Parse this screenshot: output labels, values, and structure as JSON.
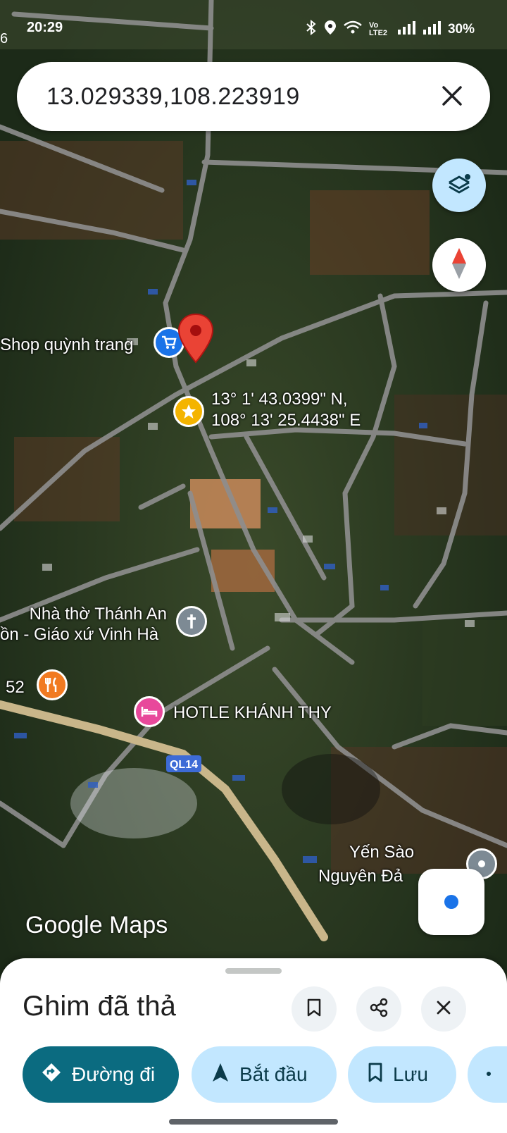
{
  "status_bar": {
    "time": "20:29",
    "edge_text": "6",
    "network": "Vo LTE2",
    "battery": "30%"
  },
  "search": {
    "query": "13.029339,108.223919"
  },
  "map": {
    "labels": {
      "shop": "Shop quỳnh trang",
      "pin_coords_line1": "13° 1' 43.0399\" N,",
      "pin_coords_line2": "108° 13' 25.4438\" E",
      "church_line1": "Nhà thờ Thánh An",
      "church_line2": "ồn - Giáo xứ Vinh Hà",
      "restaurant": "52",
      "hotel": "HOTLE KHÁNH THY",
      "road": "QL14",
      "place_line1": "Yến Sào",
      "place_line2": "Nguyên Đả"
    },
    "watermark_google": "Google",
    "watermark_maps": "Maps"
  },
  "sheet": {
    "title": "Ghim đã thả",
    "actions": {
      "directions": "Đường đi",
      "start": "Bắt đầu",
      "save": "Lưu"
    }
  },
  "colors": {
    "primary_button": "#0b6b80",
    "tonal_button": "#c2e7ff",
    "pin": "#ea4335"
  },
  "icons": [
    "bluetooth-icon",
    "location-icon",
    "wifi-icon",
    "signal-icon",
    "close-icon",
    "layers-icon",
    "compass-icon",
    "my-location-icon",
    "cart-icon",
    "star-icon",
    "cross-icon",
    "fork-knife-icon",
    "bed-icon",
    "bookmark-icon",
    "share-icon",
    "directions-icon",
    "navigation-arrow-icon"
  ]
}
